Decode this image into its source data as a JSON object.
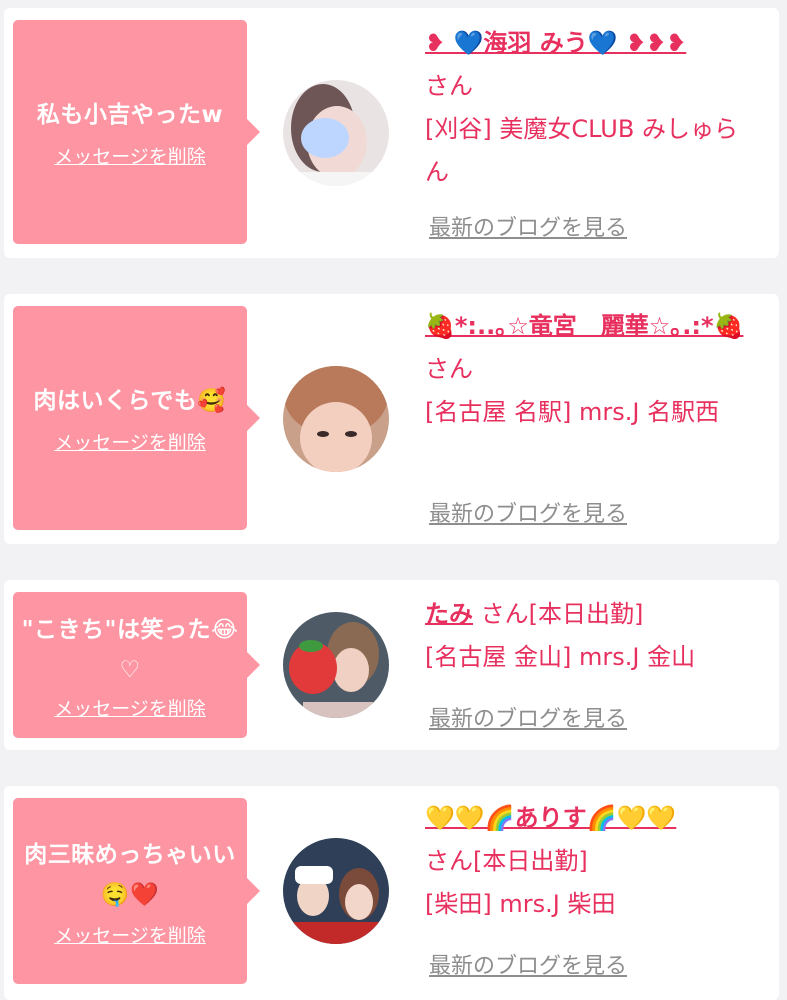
{
  "entries": [
    {
      "message": "私も小吉やったw",
      "delete_label": "メッセージを削除",
      "name": "❥ 💙海羽 みう💙 ❥❥❥",
      "suffix": "さん",
      "shop": "[刈谷] 美魔女CLUB みしゅらん",
      "blog_label": "最新のブログを見る"
    },
    {
      "message": "肉はいくらでも🥰",
      "delete_label": "メッセージを削除",
      "name": "🍓*:..｡☆竜宮　麗華☆｡.:*🍓",
      "suffix": "さん",
      "shop": "[名古屋 名駅] mrs.J 名駅西",
      "blog_label": "最新のブログを見る"
    },
    {
      "message": "\"こきち\"は笑った😂♡",
      "delete_label": "メッセージを削除",
      "name": "たみ",
      "suffix": "さん[本日出勤]",
      "shop": "[名古屋 金山] mrs.J 金山",
      "blog_label": "最新のブログを見る"
    },
    {
      "message": "肉三昧めっちゃいい🤤❤️",
      "delete_label": "メッセージを削除",
      "name": "💛💛🌈ありす🌈💛💛",
      "suffix": "さん[本日出勤]",
      "shop": "[柴田] mrs.J 柴田",
      "blog_label": "最新のブログを見る"
    }
  ]
}
